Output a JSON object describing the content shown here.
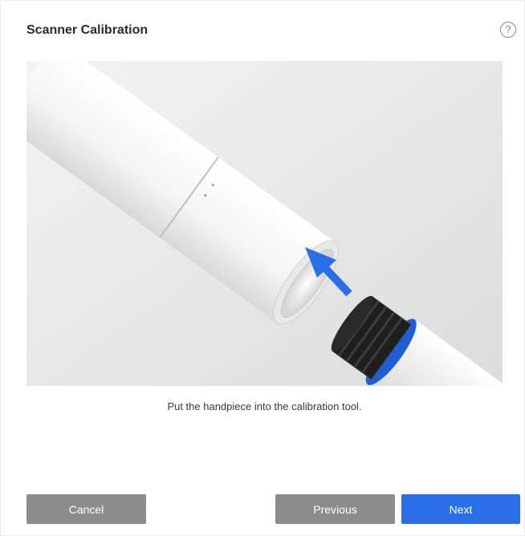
{
  "dialog": {
    "title": "Scanner Calibration",
    "help_icon": "question-circle-icon",
    "help_glyph": "?"
  },
  "illustration": {
    "description_icon": "handpiece-into-calibration-tool-illustration",
    "arrow_color": "#2a6fe8",
    "ring_color": "#1f5fd6"
  },
  "instruction": "Put the handpiece into the calibration tool.",
  "buttons": {
    "cancel": "Cancel",
    "previous": "Previous",
    "next": "Next"
  },
  "colors": {
    "primary": "#2a6fe8",
    "secondary": "#8c8c8c"
  }
}
